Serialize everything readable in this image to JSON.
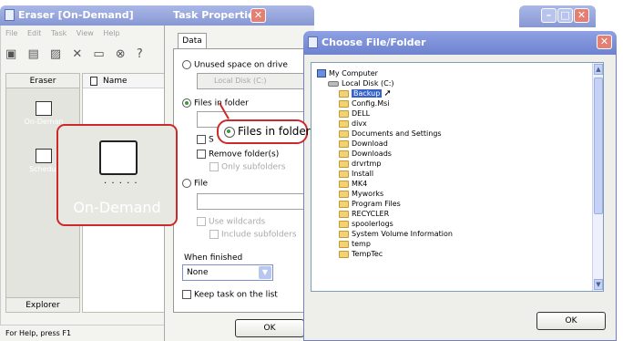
{
  "eraser_window": {
    "title": "Eraser  [On-Demand]",
    "menu": [
      "File",
      "Edit",
      "Task",
      "View",
      "Help"
    ],
    "toolbar_icons": [
      "new-icon",
      "open-icon",
      "properties-icon",
      "delete-icon",
      "copy-icon",
      "stop-icon",
      "help-icon"
    ],
    "panel_header": "Eraser",
    "panel_items": [
      "On-Deman",
      "Schedul"
    ],
    "panel_footer": "Explorer",
    "list_header": "Name",
    "status": "For Help, press F1"
  },
  "task_properties": {
    "title": "Task Properties",
    "tab": "Data",
    "options": {
      "unused_space": "Unused space on drive",
      "unused_drive_value": "Local Disk (C:)",
      "files_in_folder": "Files in folder",
      "subfolders_partial": "S",
      "remove_folders": "Remove folder(s)",
      "only_subfolders": "Only subfolders",
      "file": "File",
      "use_wildcards": "Use wildcards",
      "include_subfolders": "Include subfolders"
    },
    "when_finished_label": "When finished",
    "when_finished_value": "None",
    "keep_task": "Keep task on the list",
    "ok": "OK"
  },
  "choose_dialog": {
    "title": "Choose File/Folder",
    "tree": {
      "root": "My Computer",
      "drive": "Local Disk (C:)",
      "folders": [
        "Backup",
        "Config.Msi",
        "DELL",
        "divx",
        "Documents and Settings",
        "Download",
        "Downloads",
        "drvrtmp",
        "Install",
        "MK4",
        "Myworks",
        "Program Files",
        "RECYCLER",
        "spoolerlogs",
        "System Volume Information",
        "temp",
        "TempTec"
      ],
      "selected": "Backup"
    },
    "ok": "OK"
  },
  "callouts": {
    "big_label": "On-Demand",
    "big_dots": "· · · · ·",
    "small_label": "Files in folder"
  },
  "colors": {
    "title_blue": "#8797d3",
    "callout_red": "#cc2a2a",
    "selection": "#3461c9"
  }
}
